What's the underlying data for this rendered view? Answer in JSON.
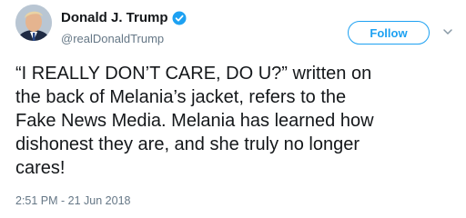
{
  "author": {
    "display_name": "Donald J. Trump",
    "handle": "@realDonaldTrump",
    "verified": true,
    "avatar_icon": "profile-photo",
    "verified_icon": "verified-badge-icon"
  },
  "actions": {
    "follow_label": "Follow",
    "more_icon": "chevron-down-icon"
  },
  "tweet": {
    "lines": [
      "“I REALLY DON’T CARE, DO U?” written on",
      "the back of Melania’s jacket, refers to the",
      "Fake News Media. Melania has learned how",
      "dishonest they are, and she truly no longer",
      "cares!"
    ],
    "timestamp": "2:51 PM - 21 Jun 2018"
  },
  "colors": {
    "accent": "#1da1f2",
    "text": "#14171a",
    "secondary": "#657786"
  }
}
